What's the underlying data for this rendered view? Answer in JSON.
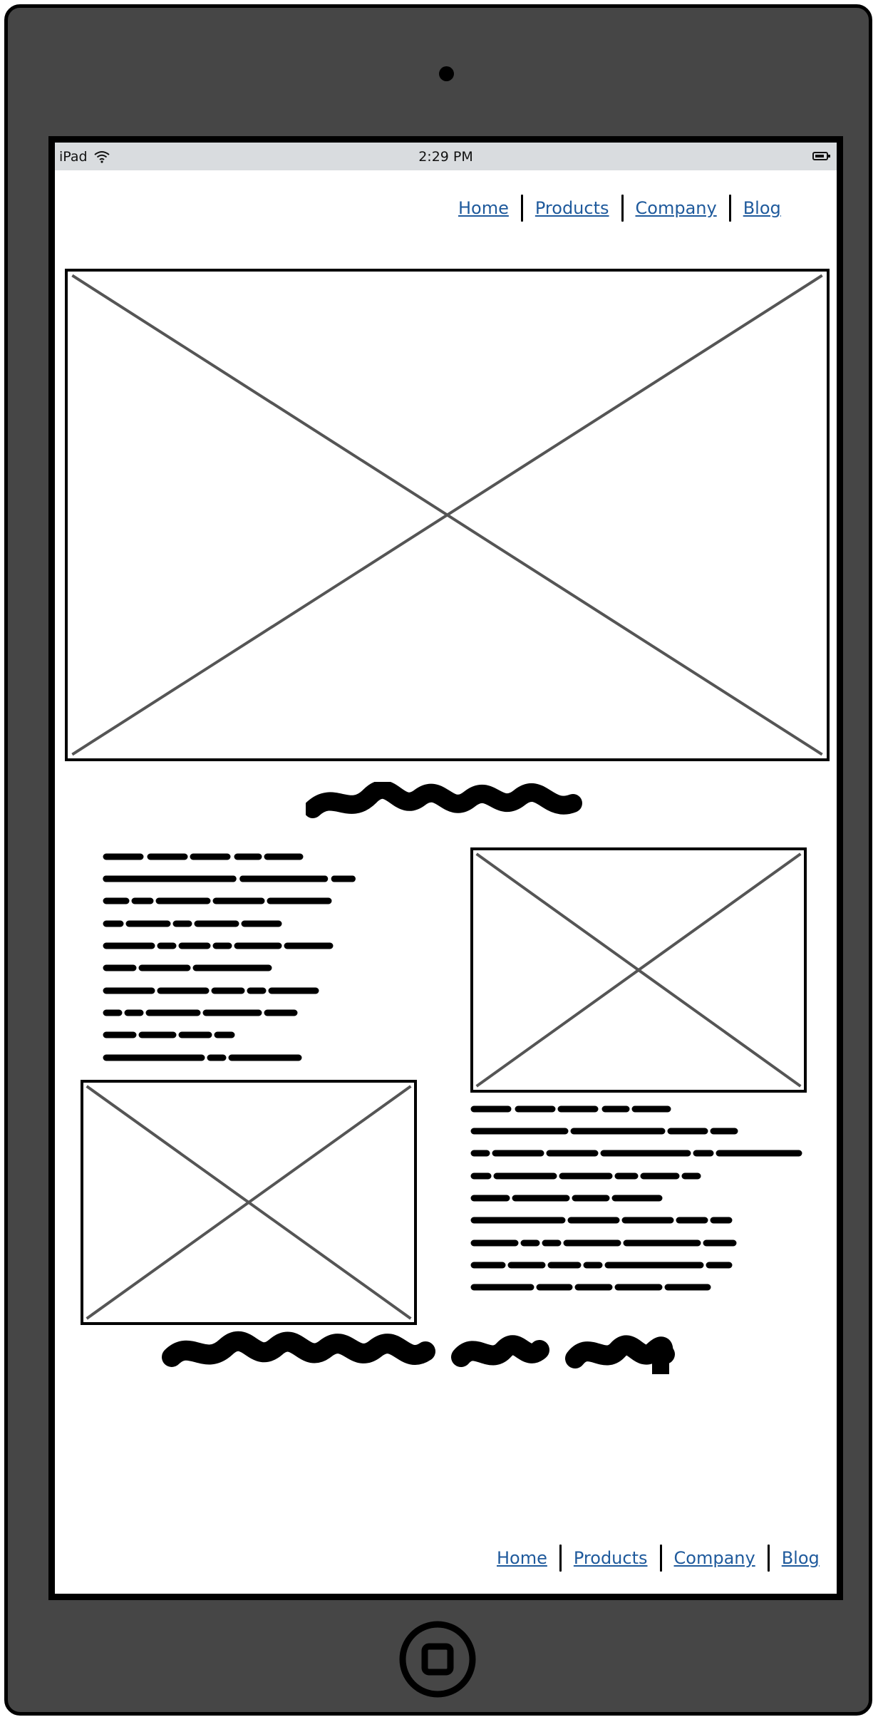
{
  "device": {
    "name": "iPad",
    "time": "2:29 PM"
  },
  "nav_top": {
    "items": [
      "Home",
      "Products",
      "Company",
      "Blog"
    ]
  },
  "nav_bottom": {
    "items": [
      "Home",
      "Products",
      "Company",
      "Blog"
    ]
  },
  "placeholders": {
    "hero": "image-placeholder",
    "right": "image-placeholder",
    "left": "image-placeholder"
  },
  "colors": {
    "device_body": "#464646",
    "status_bar": "#d9dcdf",
    "link": "#1f5a9c",
    "placeholder_cross": "#555555"
  }
}
